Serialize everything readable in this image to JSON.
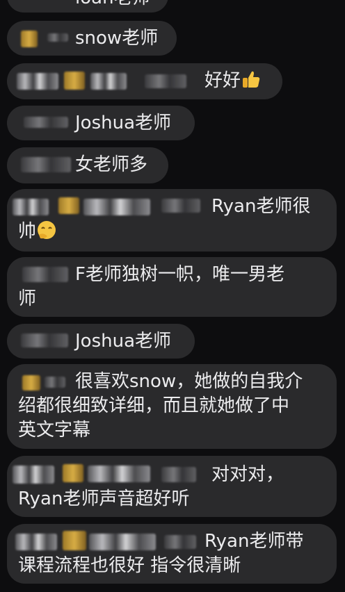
{
  "messages": [
    {
      "id": "m0",
      "text": "ioan老师"
    },
    {
      "id": "m1",
      "text": "snow老师"
    },
    {
      "id": "m2",
      "text": "好好",
      "emoji": "thumbs-up-icon"
    },
    {
      "id": "m3",
      "text": "Joshua老师"
    },
    {
      "id": "m4",
      "text": "女老师多"
    },
    {
      "id": "m5",
      "lines": [
        "Ryan老师很",
        "帅"
      ],
      "emoji": "smiling-face-with-hand-icon"
    },
    {
      "id": "m6",
      "lines": [
        "F老师独树一帜，唯一男老",
        "师"
      ]
    },
    {
      "id": "m7",
      "text": "Joshua老师"
    },
    {
      "id": "m8",
      "lines": [
        "很喜欢snow，她做的自我介",
        "绍都很细致详细，而且就她做了中",
        "英文字幕"
      ]
    },
    {
      "id": "m9",
      "lines": [
        "对对对，",
        "Ryan老师声音超好听"
      ]
    },
    {
      "id": "m10",
      "lines": [
        "Ryan老师带",
        "课程流程也很好 指令很清晰"
      ]
    }
  ]
}
